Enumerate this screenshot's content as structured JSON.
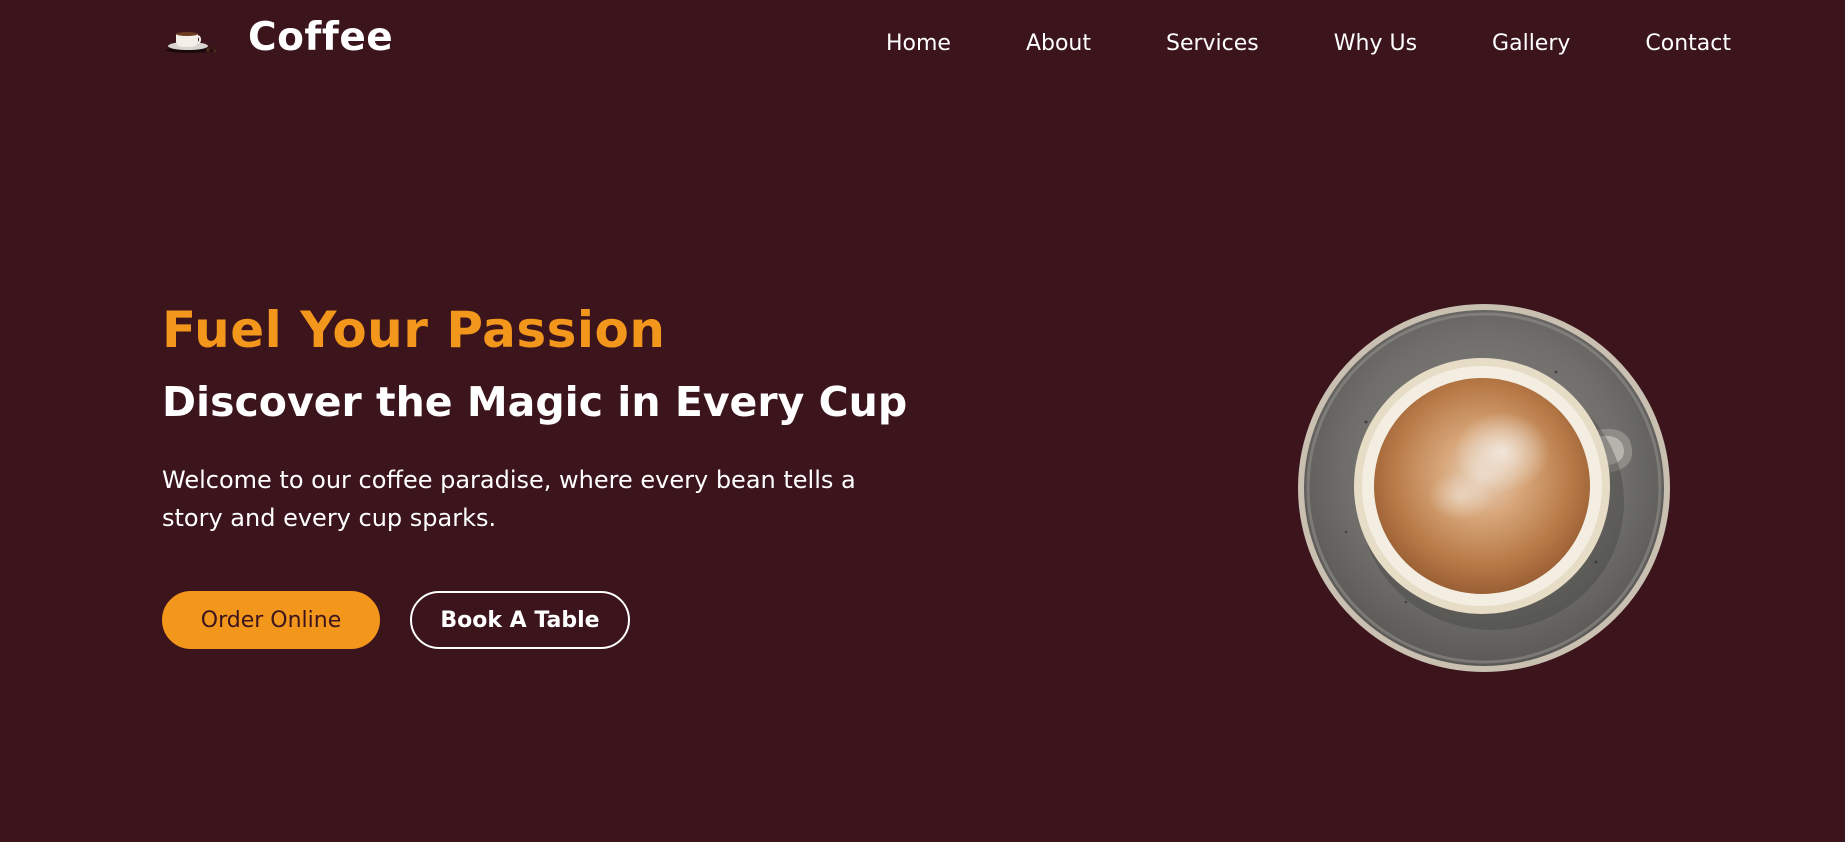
{
  "header": {
    "brand": {
      "logo_icon": "coffee-cup-logo-icon",
      "name": "Coffee"
    },
    "nav": {
      "items": [
        {
          "label": "Home"
        },
        {
          "label": "About"
        },
        {
          "label": "Services"
        },
        {
          "label": "Why Us"
        },
        {
          "label": "Gallery"
        },
        {
          "label": "Contact"
        }
      ]
    }
  },
  "hero": {
    "title": "Fuel Your Passion",
    "subtitle": "Discover the Magic in Every Cup",
    "description": "Welcome to our coffee paradise, where every bean tells a story and every cup sparks.",
    "buttons": {
      "order_label": "Order Online",
      "book_label": "Book A Table"
    },
    "image_icon": "coffee-cup-image"
  },
  "colors": {
    "background": "#3b141c",
    "accent": "#f3961c",
    "text": "#ffffff"
  }
}
